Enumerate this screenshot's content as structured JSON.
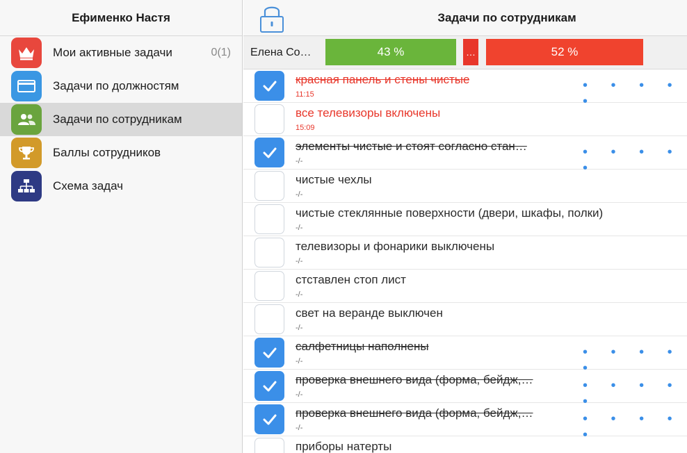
{
  "sidebar": {
    "title": "Ефименко Настя",
    "items": [
      {
        "label": "Мои активные задачи",
        "count": "0(1)",
        "icon": "crown-icon",
        "color": "#e8473d"
      },
      {
        "label": "Задачи по должностям",
        "count": "",
        "icon": "card-icon",
        "color": "#3a97e3"
      },
      {
        "label": "Задачи по сотрудникам",
        "count": "",
        "icon": "people-icon",
        "color": "#6aa43e",
        "active": true
      },
      {
        "label": "Баллы сотрудников",
        "count": "",
        "icon": "trophy-icon",
        "color": "#d29a2a"
      },
      {
        "label": "Схема задач",
        "count": "",
        "icon": "hierarchy-icon",
        "color": "#2e3a84"
      }
    ]
  },
  "main": {
    "title": "Задачи по сотрудникам",
    "lock_icon": "lock-icon",
    "progress": {
      "employee": "Елена Со…",
      "segments": [
        {
          "label": "43 %",
          "value": 43,
          "color": "#6ab53b"
        },
        {
          "label": "…",
          "value": 5,
          "color": "#e8372b"
        },
        {
          "label": "52 %",
          "value": 52,
          "color": "#f0432e"
        }
      ]
    },
    "tasks": [
      {
        "title": "красная панель и стены чистые",
        "sub": "11:15",
        "checked": true,
        "done": true,
        "red": true,
        "dots": true
      },
      {
        "title": "все телевизоры включены",
        "sub": "15:09",
        "checked": false,
        "done": false,
        "red": true,
        "dots": false
      },
      {
        "title": "элементы чистые и стоят согласно стан…",
        "sub": "-/-",
        "checked": true,
        "done": true,
        "red": false,
        "dots": true
      },
      {
        "title": "чистые чехлы",
        "sub": "-/-",
        "checked": false,
        "done": false,
        "red": false,
        "dots": false
      },
      {
        "title": "чистые стеклянные поверхности (двери, шкафы, полки)",
        "sub": "-/-",
        "checked": false,
        "done": false,
        "red": false,
        "dots": false
      },
      {
        "title": "телевизоры и фонарики выключены",
        "sub": "-/-",
        "checked": false,
        "done": false,
        "red": false,
        "dots": false
      },
      {
        "title": "стставлен стоп лист",
        "sub": "-/-",
        "checked": false,
        "done": false,
        "red": false,
        "dots": false
      },
      {
        "title": "свет на веранде выключен",
        "sub": "-/-",
        "checked": false,
        "done": false,
        "red": false,
        "dots": false
      },
      {
        "title": "салфетницы наполнены",
        "sub": "-/-",
        "checked": true,
        "done": true,
        "red": false,
        "dots": true
      },
      {
        "title": "проверка внешнего вида (форма, бейдж,…",
        "sub": "-/-",
        "checked": true,
        "done": true,
        "red": false,
        "dots": true
      },
      {
        "title": "проверка внешнего вида (форма, бейдж,…",
        "sub": "-/-",
        "checked": true,
        "done": true,
        "red": false,
        "dots": true
      },
      {
        "title": "приборы натерты",
        "sub": "",
        "checked": false,
        "done": false,
        "red": false,
        "dots": false
      }
    ],
    "dots_text": "• • • • •"
  }
}
